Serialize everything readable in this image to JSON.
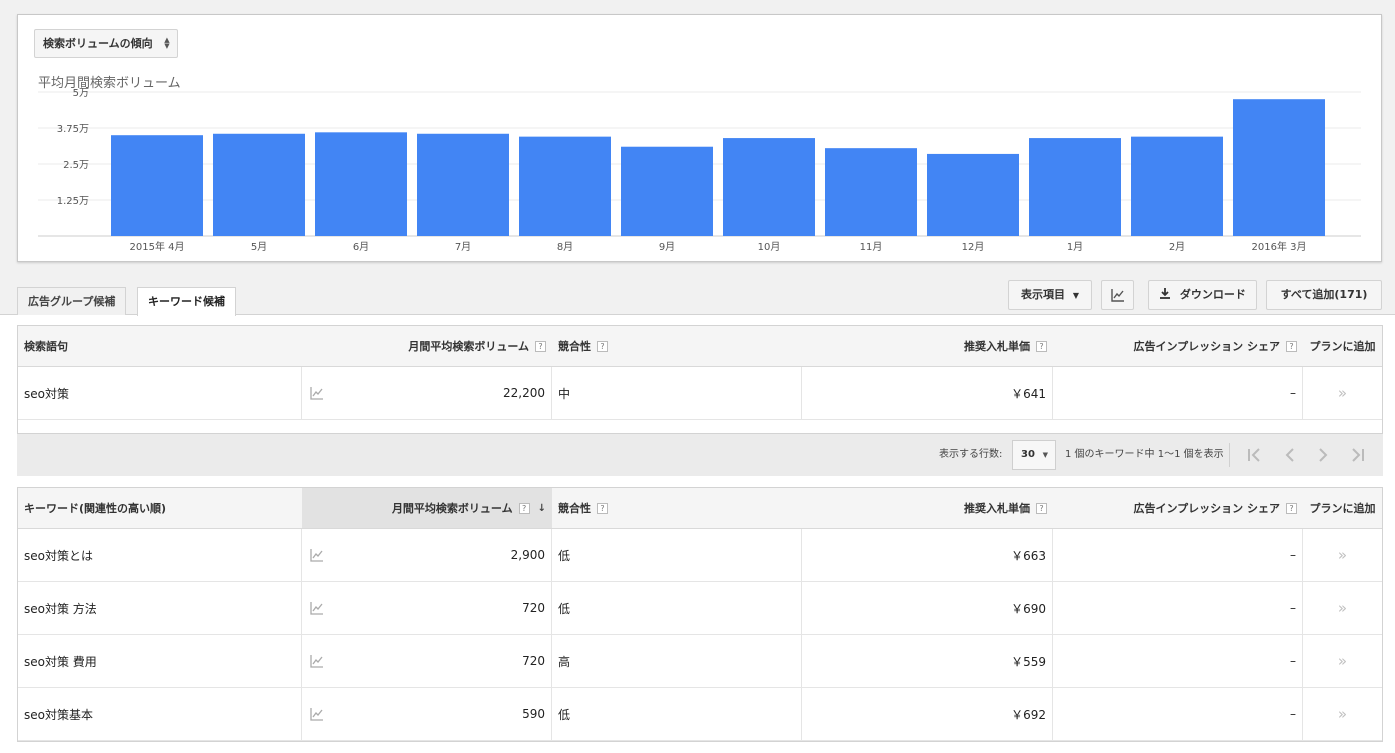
{
  "chart": {
    "selector_label": "検索ボリュームの傾向",
    "title": "平均月間検索ボリューム"
  },
  "chart_data": {
    "type": "bar",
    "title": "平均月間検索ボリューム",
    "categories": [
      "2015年 4月",
      "5月",
      "6月",
      "7月",
      "8月",
      "9月",
      "10月",
      "11月",
      "12月",
      "1月",
      "2月",
      "2016年 3月"
    ],
    "values": [
      35000,
      35500,
      36000,
      35500,
      34500,
      31000,
      34000,
      30500,
      28500,
      34000,
      34500,
      47500
    ],
    "ylim": [
      0,
      50000
    ],
    "yticks": [
      0,
      12500,
      25000,
      37500,
      50000
    ],
    "ytick_labels": [
      "",
      "1.25万",
      "2.5万",
      "3.75万",
      "5万"
    ],
    "xlabel": "",
    "ylabel": "",
    "bar_color": "#4285f4",
    "grid": true
  },
  "tabs": [
    {
      "label": "広告グループ候補",
      "active": false
    },
    {
      "label": "キーワード候補",
      "active": true
    }
  ],
  "toolbar": {
    "columns_label": "表示項目",
    "download_label": "ダウンロード",
    "add_all_label": "すべて追加(171)"
  },
  "search_table": {
    "headers": [
      "検索語句",
      "月間平均検索ボリューム",
      "競合性",
      "推奨入札単価",
      "広告インプレッション シェア",
      "プランに追加"
    ],
    "rows": [
      {
        "keyword": "seo対策",
        "volume": "22,200",
        "competition": "中",
        "bid": "￥641",
        "share": "–"
      }
    ]
  },
  "pager": {
    "rows_label": "表示する行数:",
    "rows_value": "30",
    "count_text": "1 個のキーワード中 1～1 個を表示"
  },
  "keyword_table": {
    "headers": [
      "キーワード(関連性の高い順)",
      "月間平均検索ボリューム",
      "競合性",
      "推奨入札単価",
      "広告インプレッション シェア",
      "プランに追加"
    ],
    "rows": [
      {
        "keyword": "seo対策とは",
        "volume": "2,900",
        "competition": "低",
        "bid": "￥663",
        "share": "–"
      },
      {
        "keyword": "seo対策 方法",
        "volume": "720",
        "competition": "低",
        "bid": "￥690",
        "share": "–"
      },
      {
        "keyword": "seo対策 費用",
        "volume": "720",
        "competition": "高",
        "bid": "￥559",
        "share": "–"
      },
      {
        "keyword": "seo対策基本",
        "volume": "590",
        "competition": "低",
        "bid": "￥692",
        "share": "–"
      }
    ]
  },
  "icons": {
    "trend": "trend-chart-icon",
    "add": "double-chevron-right-icon",
    "help": "question-mark-icon",
    "download": "download-icon"
  }
}
